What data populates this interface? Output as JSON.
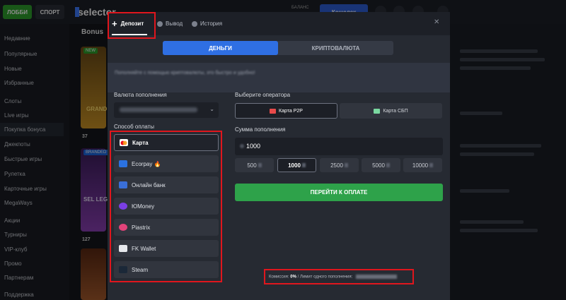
{
  "topbar": {
    "lobby_label": "ЛОББИ",
    "sport_label": "СПОРТ",
    "logo": "selector",
    "balance_label": "БАЛАНС",
    "wallet_label": "Кошелек"
  },
  "sidebar": {
    "items": [
      "Недавние",
      "Популярные",
      "Новые",
      "Избранные",
      "Слоты",
      "Live игры",
      "Покупка бонуса",
      "Джекпоты",
      "Быстрые игры",
      "Рулетка",
      "Карточные игры",
      "MegaWays",
      "Акции",
      "Турниры",
      "VIP-клуб",
      "Промо",
      "Партнерам",
      "Поддержка"
    ]
  },
  "content": {
    "section_title": "Bonus",
    "badge_new": "NEW",
    "badge_branded": "BRANDED",
    "card1_text": "GRAND",
    "card2_text": "SEL LEG",
    "count1": "37",
    "count2": "127"
  },
  "modal": {
    "tabs": [
      "Депозит",
      "Вывод",
      "История"
    ],
    "segments": [
      "ДЕНЬГИ",
      "КРИПТОВАЛЮТА"
    ],
    "banner_text": "Пополняйте с помощью криптовалюты, это быстро и удобно!",
    "currency_label": "Валюта пополнения",
    "payment_method_label": "Способ оплаты",
    "payment_methods": [
      "Карта",
      "Ecorpay 🔥",
      "Онлайн банк",
      "ЮMoney",
      "Piastrix",
      "FK Wallet",
      "Steam"
    ],
    "operator_label": "Выберите оператора",
    "operators": [
      "Карта P2P",
      "Карта СБП"
    ],
    "amount_label": "Сумма пополнения",
    "amount_value": "1000",
    "presets": [
      "500",
      "1000",
      "2500",
      "5000",
      "10000"
    ],
    "pay_button": "ПЕРЕЙТИ К ОПЛАТЕ",
    "commission_label": "Комиссия:",
    "commission_value": "0%",
    "limit_label": "/ Лимит одного пополнения:"
  },
  "colors": {
    "accent_blue": "#2f6fe3",
    "pay_green": "#2ea24a",
    "highlight_red": "#e0161d",
    "lobby_green": "#2f9e2c"
  }
}
